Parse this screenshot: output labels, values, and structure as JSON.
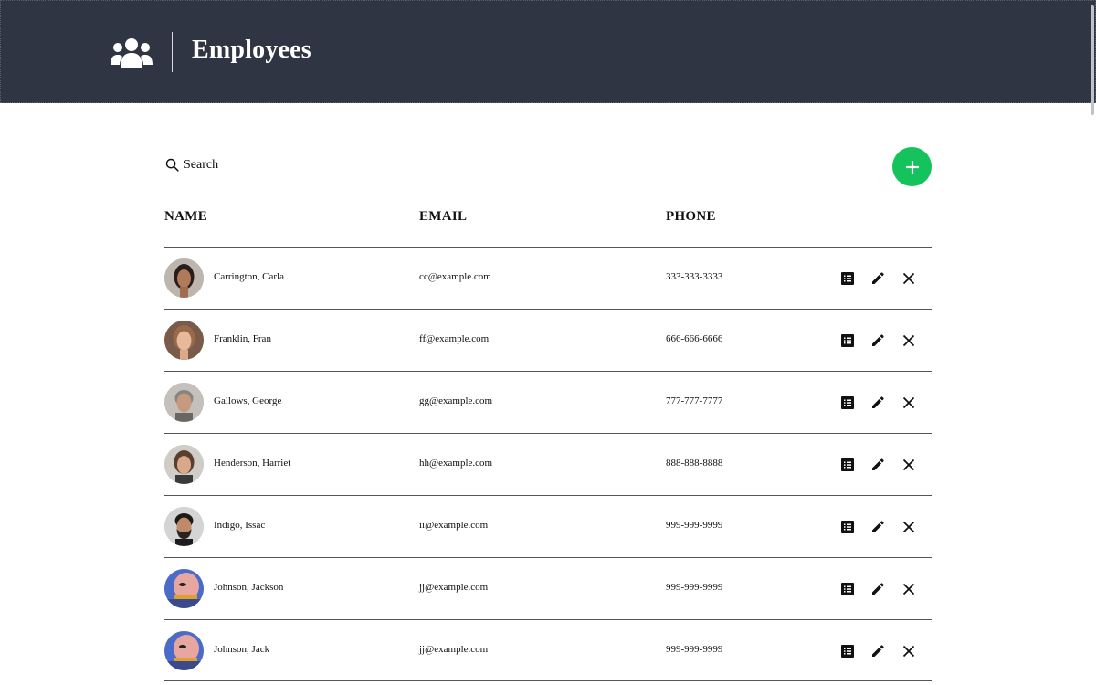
{
  "header": {
    "title": "Employees",
    "icon": "group-icon",
    "background": "#303544"
  },
  "toolbar": {
    "search_label": "Search",
    "add_icon": "plus-icon",
    "add_color": "#14c35c"
  },
  "table": {
    "columns": [
      "NAME",
      "EMAIL",
      "PHONE"
    ],
    "rows": [
      {
        "name": "Carrington, Carla",
        "email": "cc@example.com",
        "phone": "333-333-3333",
        "avatar": "woman-dark-hair"
      },
      {
        "name": "Franklin, Fran",
        "email": "ff@example.com",
        "phone": "666-666-6666",
        "avatar": "woman-light-hair"
      },
      {
        "name": "Gallows, George",
        "email": "gg@example.com",
        "phone": "777-777-7777",
        "avatar": "man-grey-hair"
      },
      {
        "name": "Henderson, Harriet",
        "email": "hh@example.com",
        "phone": "888-888-8888",
        "avatar": "woman-brown-hair"
      },
      {
        "name": "Indigo, Issac",
        "email": "ii@example.com",
        "phone": "999-999-9999",
        "avatar": "man-beard"
      },
      {
        "name": "Johnson, Jackson",
        "email": "jj@example.com",
        "phone": "999-999-9999",
        "avatar": "cartoon-character"
      },
      {
        "name": "Johnson, Jack",
        "email": "jj@example.com",
        "phone": "999-999-9999",
        "avatar": "cartoon-character"
      }
    ],
    "row_actions": [
      "details-icon",
      "edit-pencil-icon",
      "close-icon"
    ]
  }
}
